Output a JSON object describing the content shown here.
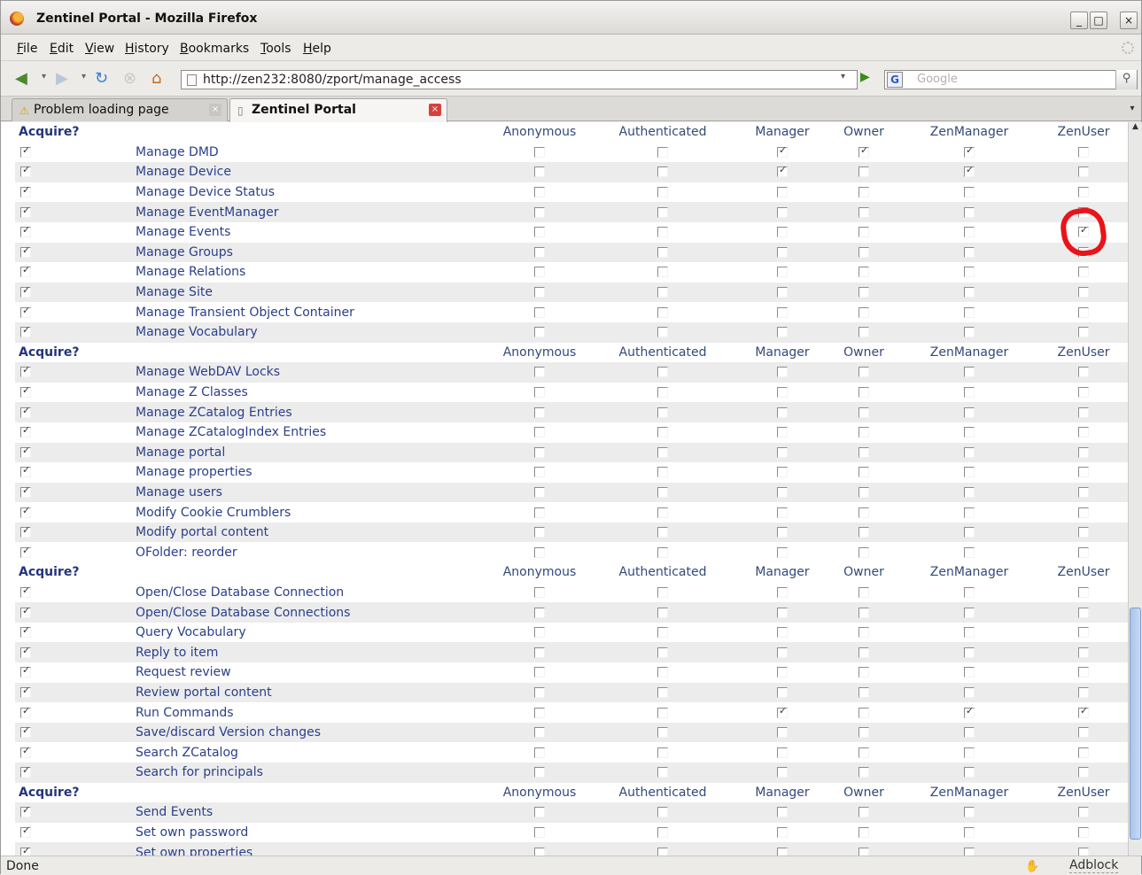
{
  "window": {
    "title": "Zentinel Portal - Mozilla Firefox",
    "min": "_",
    "max": "□",
    "close": "×"
  },
  "menu": [
    "File",
    "Edit",
    "View",
    "History",
    "Bookmarks",
    "Tools",
    "Help"
  ],
  "nav": {
    "url": "http://zen232:8080/zport/manage_access",
    "search_engine": "G",
    "search_placeholder": "Google"
  },
  "tabs": [
    {
      "label": "Problem loading page",
      "icon": "warning-icon"
    },
    {
      "label": "Zentinel Portal",
      "icon": "page-icon"
    }
  ],
  "table": {
    "header": {
      "acquire": "Acquire?",
      "roles": [
        "Anonymous",
        "Authenticated",
        "Manager",
        "Owner",
        "ZenManager",
        "ZenUser"
      ]
    },
    "groups": [
      [
        {
          "name": "Manage DMD",
          "roles": [
            0,
            0,
            1,
            1,
            1,
            0
          ]
        },
        {
          "name": "Manage Device",
          "roles": [
            0,
            0,
            1,
            0,
            1,
            0
          ]
        },
        {
          "name": "Manage Device Status",
          "roles": [
            0,
            0,
            0,
            0,
            0,
            0
          ]
        },
        {
          "name": "Manage EventManager",
          "roles": [
            0,
            0,
            0,
            0,
            0,
            0
          ]
        },
        {
          "name": "Manage Events",
          "roles": [
            0,
            0,
            0,
            0,
            0,
            1
          ]
        },
        {
          "name": "Manage Groups",
          "roles": [
            0,
            0,
            0,
            0,
            0,
            0
          ]
        },
        {
          "name": "Manage Relations",
          "roles": [
            0,
            0,
            0,
            0,
            0,
            0
          ]
        },
        {
          "name": "Manage Site",
          "roles": [
            0,
            0,
            0,
            0,
            0,
            0
          ]
        },
        {
          "name": "Manage Transient Object Container",
          "roles": [
            0,
            0,
            0,
            0,
            0,
            0
          ]
        },
        {
          "name": "Manage Vocabulary",
          "roles": [
            0,
            0,
            0,
            0,
            0,
            0
          ]
        }
      ],
      [
        {
          "name": "Manage WebDAV Locks",
          "roles": [
            0,
            0,
            0,
            0,
            0,
            0
          ]
        },
        {
          "name": "Manage Z Classes",
          "roles": [
            0,
            0,
            0,
            0,
            0,
            0
          ]
        },
        {
          "name": "Manage ZCatalog Entries",
          "roles": [
            0,
            0,
            0,
            0,
            0,
            0
          ]
        },
        {
          "name": "Manage ZCatalogIndex Entries",
          "roles": [
            0,
            0,
            0,
            0,
            0,
            0
          ]
        },
        {
          "name": "Manage portal",
          "roles": [
            0,
            0,
            0,
            0,
            0,
            0
          ]
        },
        {
          "name": "Manage properties",
          "roles": [
            0,
            0,
            0,
            0,
            0,
            0
          ]
        },
        {
          "name": "Manage users",
          "roles": [
            0,
            0,
            0,
            0,
            0,
            0
          ]
        },
        {
          "name": "Modify Cookie Crumblers",
          "roles": [
            0,
            0,
            0,
            0,
            0,
            0
          ]
        },
        {
          "name": "Modify portal content",
          "roles": [
            0,
            0,
            0,
            0,
            0,
            0
          ]
        },
        {
          "name": "OFolder: reorder",
          "roles": [
            0,
            0,
            0,
            0,
            0,
            0
          ]
        }
      ],
      [
        {
          "name": "Open/Close Database Connection",
          "roles": [
            0,
            0,
            0,
            0,
            0,
            0
          ]
        },
        {
          "name": "Open/Close Database Connections",
          "roles": [
            0,
            0,
            0,
            0,
            0,
            0
          ]
        },
        {
          "name": "Query Vocabulary",
          "roles": [
            0,
            0,
            0,
            0,
            0,
            0
          ]
        },
        {
          "name": "Reply to item",
          "roles": [
            0,
            0,
            0,
            0,
            0,
            0
          ]
        },
        {
          "name": "Request review",
          "roles": [
            0,
            0,
            0,
            0,
            0,
            0
          ]
        },
        {
          "name": "Review portal content",
          "roles": [
            0,
            0,
            0,
            0,
            0,
            0
          ]
        },
        {
          "name": "Run Commands",
          "roles": [
            0,
            0,
            1,
            0,
            1,
            1
          ]
        },
        {
          "name": "Save/discard Version changes",
          "roles": [
            0,
            0,
            0,
            0,
            0,
            0
          ]
        },
        {
          "name": "Search ZCatalog",
          "roles": [
            0,
            0,
            0,
            0,
            0,
            0
          ]
        },
        {
          "name": "Search for principals",
          "roles": [
            0,
            0,
            0,
            0,
            0,
            0
          ]
        }
      ],
      [
        {
          "name": "Send Events",
          "roles": [
            0,
            0,
            0,
            0,
            0,
            0
          ]
        },
        {
          "name": "Set own password",
          "roles": [
            0,
            0,
            0,
            0,
            0,
            0
          ]
        },
        {
          "name": "Set own properties",
          "roles": [
            0,
            0,
            0,
            0,
            0,
            0
          ]
        }
      ]
    ],
    "highlight": {
      "permission": "Manage Events",
      "role": "ZenUser",
      "color": "#e8141a"
    }
  },
  "status": {
    "text": "Done",
    "addon": "Adblock"
  }
}
